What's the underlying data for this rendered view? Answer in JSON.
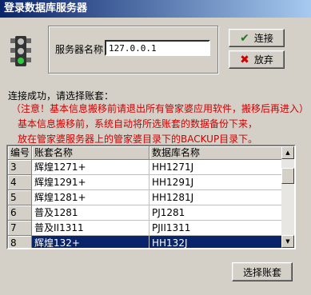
{
  "window": {
    "title": "登录数据库服务器"
  },
  "server": {
    "label": "服务器名称",
    "value": "127.0.0.1"
  },
  "buttons": {
    "connect": "连接",
    "cancel": "放弃",
    "select_account": "选择账套"
  },
  "status": "连接成功，请选择账套：",
  "notes": [
    "（注意！基本信息搬移前请退出所有管家婆应用软件，搬移后再进入）",
    "基本信息搬移前，系统自动将所选账套的数据备份下来，",
    "放在管家婆服务器上的管家婆目录下的BACKUP目录下。"
  ],
  "grid": {
    "headers": [
      "编号",
      "账套名称",
      "数据库名称"
    ],
    "rows": [
      {
        "id": "3",
        "name": "辉煌1271+",
        "db": "HH1271J"
      },
      {
        "id": "4",
        "name": "辉煌1291+",
        "db": "HH1291J"
      },
      {
        "id": "5",
        "name": "辉煌1281+",
        "db": "HH1281J"
      },
      {
        "id": "6",
        "name": "普及1281",
        "db": "PJ1281"
      },
      {
        "id": "7",
        "name": "普及II1311",
        "db": "PJII1311"
      },
      {
        "id": "8",
        "name": "辉煌132+",
        "db": "HH132J"
      }
    ],
    "selected_row": 5
  },
  "icons": {
    "traffic_light": "traffic-light-icon",
    "connect": "check-icon",
    "cancel": "x-icon"
  },
  "colors": {
    "title_bar": "#0a246a",
    "note_text": "#d00000",
    "selection": "#0a246a"
  }
}
